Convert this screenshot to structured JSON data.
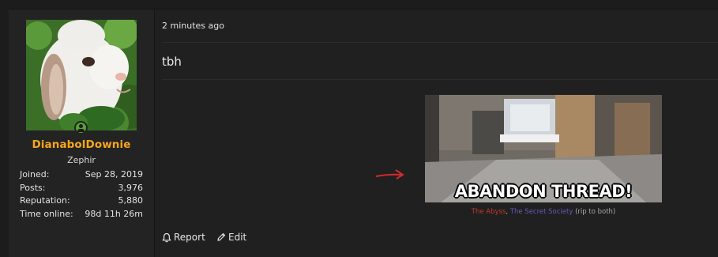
{
  "user": {
    "username": "DianabolDownie",
    "title": "Zephir",
    "username_color": "#f7a71b",
    "online_status_color": "#58a234",
    "stats": [
      {
        "label": "Joined:",
        "value": "Sep 28, 2019"
      },
      {
        "label": "Posts:",
        "value": "3,976"
      },
      {
        "label": "Reputation:",
        "value": "5,880"
      },
      {
        "label": "Time online:",
        "value": "98d 11h 26m"
      }
    ]
  },
  "post": {
    "timestamp": "2 minutes ago",
    "message": "tbh",
    "image_caption": "ABANDON THREAD!",
    "signature": {
      "link1": "The Abyss",
      "separator": ",",
      "link2": "The Secret Society",
      "suffix": "(rip to both)"
    }
  },
  "actions": {
    "report": "Report",
    "edit": "Edit"
  },
  "icons": {
    "online": "user-online-icon",
    "arrow": "red-arrow-icon",
    "report": "bell-icon",
    "edit": "pencil-icon"
  },
  "colors": {
    "background": "#1c1c1c",
    "post": "#202020",
    "arrow": "#d32a2a",
    "link1": "#c0392b",
    "link2": "#6a57b8"
  }
}
